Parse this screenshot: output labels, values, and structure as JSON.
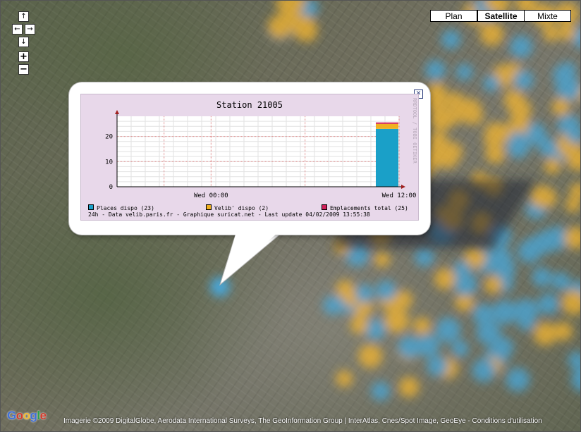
{
  "map": {
    "nav": {
      "up": "↑",
      "left": "←",
      "right": "→",
      "down": "↓",
      "zoom_in": "+",
      "zoom_out": "−"
    },
    "map_types": [
      {
        "label": "Plan",
        "active": false
      },
      {
        "label": "Satellite",
        "active": true
      },
      {
        "label": "Mixte",
        "active": false
      }
    ],
    "google_logo": [
      "G",
      "o",
      "o",
      "g",
      "l",
      "e"
    ],
    "logo_colors": [
      "#3f6fd8",
      "#d33b2c",
      "#f2b92f",
      "#3f6fd8",
      "#2ba14b",
      "#d33b2c"
    ],
    "copyright": "Imagerie ©2009 DigitalGlobe, Aerodata International Surveys, The GeoInformation Group | InterAtlas, Cnes/Spot Image, GeoEye - Conditions d'utilisation",
    "overlay_colors": {
      "blue": "#4aa6d6",
      "yellow": "#f0b431"
    }
  },
  "popup": {
    "close_glyph": "✕",
    "watermark": "RRDTOOL / TOBI OETIKER",
    "legend": [
      {
        "label": "Places dispo (23)",
        "color": "#1aa0c8"
      },
      {
        "label": "Velib' dispo (2)",
        "color": "#f0b020"
      },
      {
        "label": "Emplacements total (25)",
        "color": "#d0205a"
      }
    ],
    "footer": "24h - Data velib.paris.fr - Graphique suricat.net - Last update 04/02/2009 13:55:38"
  },
  "chart_data": {
    "type": "area",
    "title": "Station 21005",
    "x_ticks": [
      "Wed 00:00",
      "Wed 12:00"
    ],
    "y_ticks": [
      0,
      10,
      20
    ],
    "ylim": [
      0,
      28
    ],
    "grid": true,
    "series": [
      {
        "name": "Places dispo (23)",
        "values": [
          23
        ],
        "color": "#1aa0c8"
      },
      {
        "name": "Velib' dispo (2)",
        "values": [
          2
        ],
        "color": "#f0b020"
      },
      {
        "name": "Emplacements total (25)",
        "values": [
          25
        ],
        "color": "#d0205a"
      }
    ]
  }
}
